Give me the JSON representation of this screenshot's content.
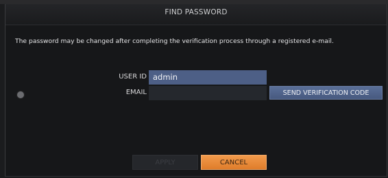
{
  "dialog": {
    "title": "FIND PASSWORD",
    "description": "The password may be changed after completing the verification process through a registered e-mail."
  },
  "form": {
    "userid_label": "USER ID",
    "userid_value": "admin",
    "email_label": "EMAIL",
    "email_value": "",
    "send_code_label": "SEND VERIFICATION CODE"
  },
  "buttons": {
    "apply_label": "APPLY",
    "cancel_label": "CANCEL"
  },
  "colors": {
    "accent_orange": "#e8883a",
    "field_blue": "#4d5f86",
    "background": "#161719"
  }
}
